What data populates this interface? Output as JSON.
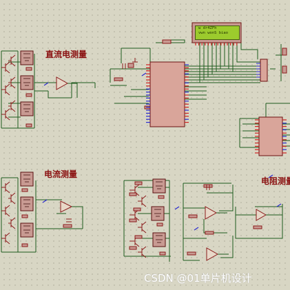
{
  "labels": {
    "dc_current": "直流电测量",
    "current": "电流测量",
    "resistance": "电阻测量"
  },
  "lcd": {
    "line1": "w dr4ZFh",
    "line2": "vwn wonS biao"
  },
  "watermark": "CSDN @01单片机设计",
  "colors": {
    "background": "#d8d6c4",
    "wire": "#1d5a1d",
    "component": "#8a1a1a",
    "ic_fill": "#d9a59a",
    "pin_red": "#d02020",
    "pin_blue": "#2a2ad0",
    "lcd_fill": "#9ccb2d"
  }
}
